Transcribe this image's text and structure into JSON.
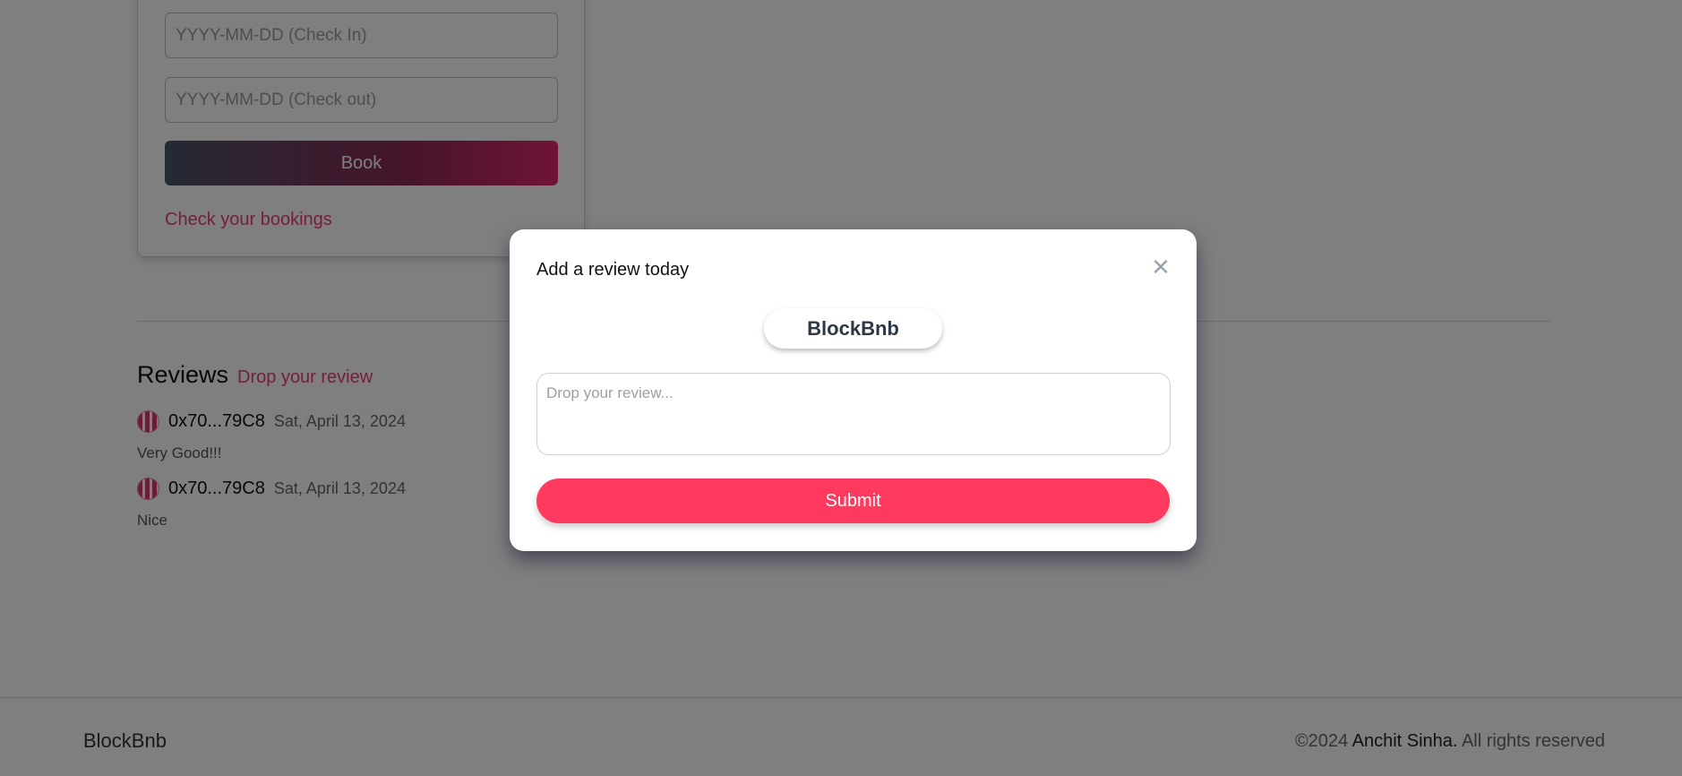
{
  "booking": {
    "check_in_placeholder": "YYYY-MM-DD (Check In)",
    "check_out_placeholder": "YYYY-MM-DD (Check out)",
    "book_label": "Book",
    "check_bookings_link": "Check your bookings"
  },
  "reviews": {
    "title": "Reviews",
    "drop_review_link": "Drop your review",
    "items": [
      {
        "address": "0x70...79C8",
        "date": "Sat, April 13, 2024",
        "text": "Very Good!!!"
      },
      {
        "address": "0x70...79C8",
        "date": "Sat, April 13, 2024",
        "text": "Nice"
      }
    ]
  },
  "footer": {
    "brand": "BlockBnb",
    "copyright_prefix": "©2024",
    "author": "Anchit Sinha.",
    "rights": "All rights reserved"
  },
  "modal": {
    "title": "Add a review today",
    "close_icon": "close-icon",
    "brand": "BlockBnb",
    "textarea_placeholder": "Drop your review...",
    "submit_label": "Submit"
  },
  "colors": {
    "accent": "#e83e74",
    "submit": "#ff3a5e",
    "overlay": "rgba(0,0,0,0.5)"
  }
}
